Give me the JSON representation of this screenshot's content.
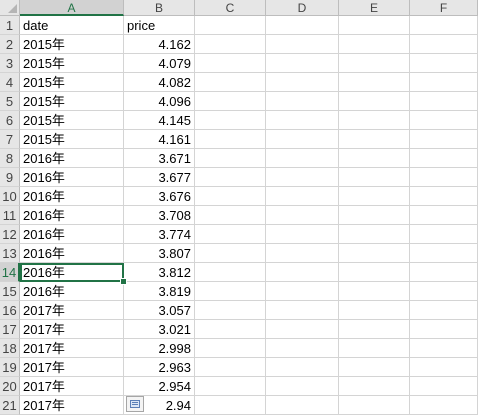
{
  "columns": [
    "A",
    "B",
    "C",
    "D",
    "E",
    "F"
  ],
  "active_column": "A",
  "active_row": "14",
  "rows": [
    {
      "num": "1",
      "a": "date",
      "b": "price"
    },
    {
      "num": "2",
      "a": "2015年",
      "b": "4.162"
    },
    {
      "num": "3",
      "a": "2015年",
      "b": "4.079"
    },
    {
      "num": "4",
      "a": "2015年",
      "b": "4.082"
    },
    {
      "num": "5",
      "a": "2015年",
      "b": "4.096"
    },
    {
      "num": "6",
      "a": "2015年",
      "b": "4.145"
    },
    {
      "num": "7",
      "a": "2015年",
      "b": "4.161"
    },
    {
      "num": "8",
      "a": "2016年",
      "b": "3.671"
    },
    {
      "num": "9",
      "a": "2016年",
      "b": "3.677"
    },
    {
      "num": "10",
      "a": "2016年",
      "b": "3.676"
    },
    {
      "num": "11",
      "a": "2016年",
      "b": "3.708"
    },
    {
      "num": "12",
      "a": "2016年",
      "b": "3.774"
    },
    {
      "num": "13",
      "a": "2016年",
      "b": "3.807"
    },
    {
      "num": "14",
      "a": "2016年",
      "b": "3.812"
    },
    {
      "num": "15",
      "a": "2016年",
      "b": "3.819"
    },
    {
      "num": "16",
      "a": "2017年",
      "b": "3.057"
    },
    {
      "num": "17",
      "a": "2017年",
      "b": "3.021"
    },
    {
      "num": "18",
      "a": "2017年",
      "b": "2.998"
    },
    {
      "num": "19",
      "a": "2017年",
      "b": "2.963"
    },
    {
      "num": "20",
      "a": "2017年",
      "b": "2.954"
    },
    {
      "num": "21",
      "a": "2017年",
      "b": "2.94"
    }
  ],
  "icons": {
    "paste_options": "paste-options-icon",
    "select_all": "select-all-icon"
  },
  "colors": {
    "selection": "#217346",
    "header_bg": "#e6e6e6",
    "grid": "#d4d4d4"
  }
}
